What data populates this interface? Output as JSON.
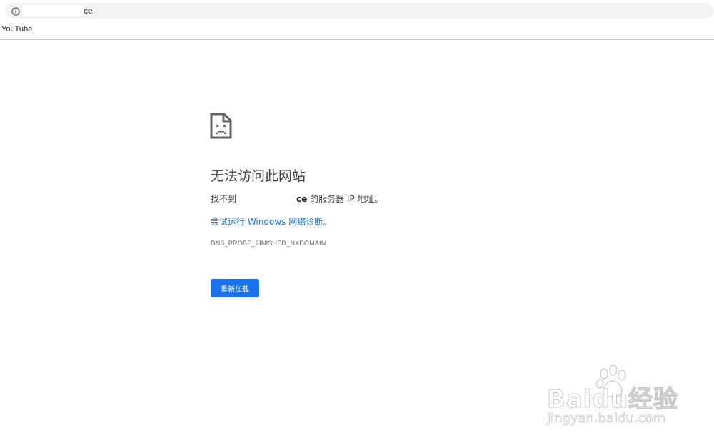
{
  "browser": {
    "url_visible": "ce",
    "bookmarks": [
      "YouTube"
    ]
  },
  "error_page": {
    "title": "无法访问此网站",
    "desc_prefix": "找不到",
    "desc_host": "ce",
    "desc_suffix": " 的服务器 IP 地址。",
    "link_text": "尝试运行 Windows 网络诊断。",
    "error_code": "DNS_PROBE_FINISHED_NXDOMAIN",
    "reload_label": "重新加载",
    "icon": "sad-page-icon"
  },
  "watermark": {
    "main": "Baidu经验",
    "sub": "jingyan.baidu.com"
  },
  "colors": {
    "accent": "#1a73e8",
    "text": "#3c4043",
    "address_bg": "#f1f3f4"
  }
}
